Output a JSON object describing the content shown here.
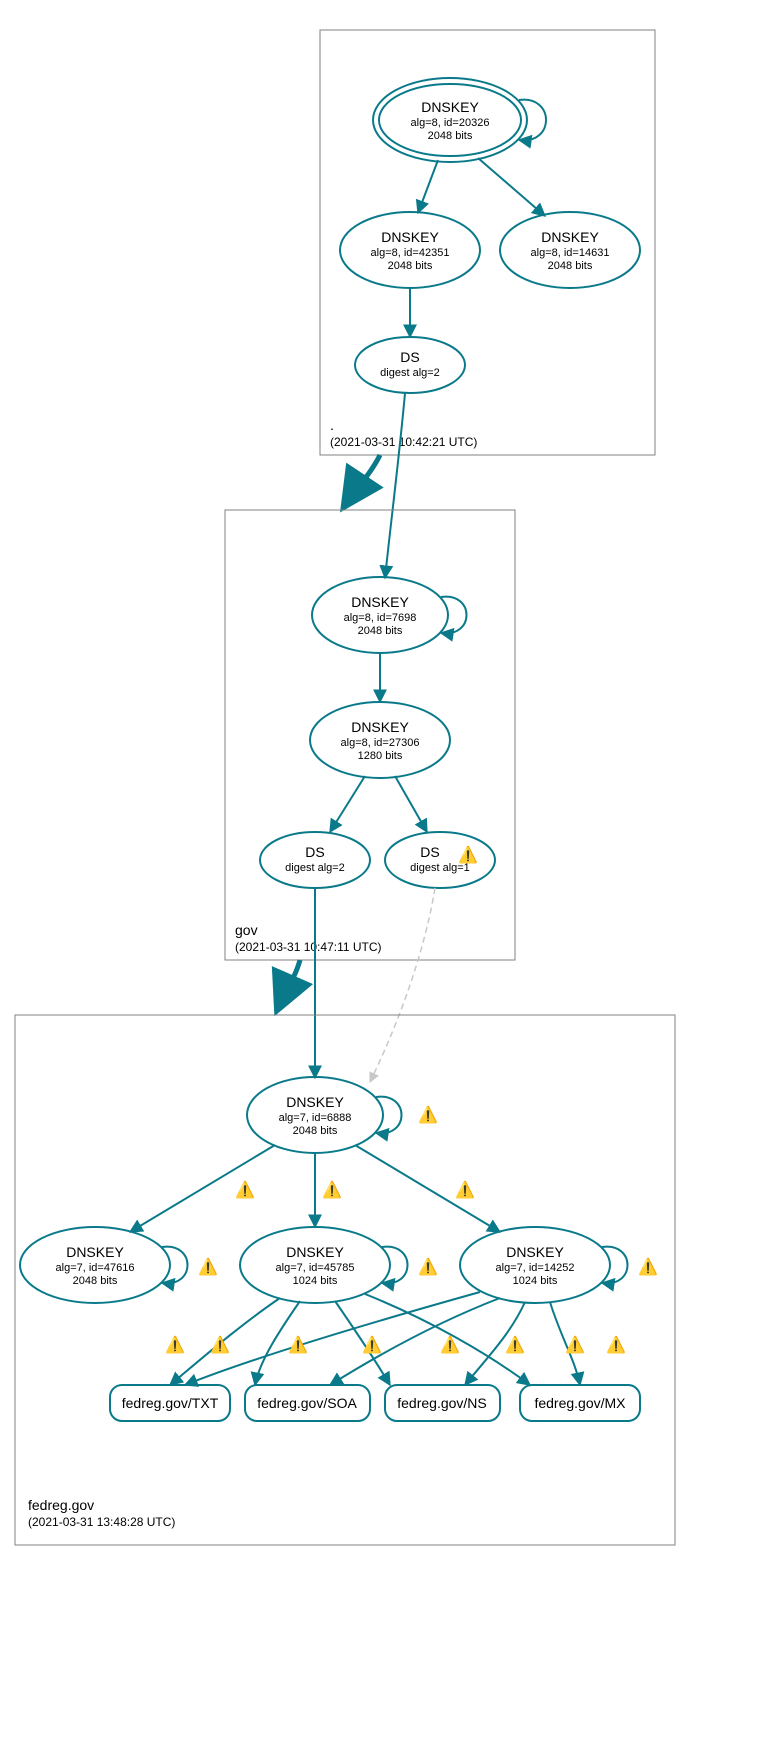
{
  "colors": {
    "teal": "#0a7a8a",
    "greyNode": "#d3d3d3",
    "zoneBorder": "#808080",
    "dashed": "#c8c8c8"
  },
  "warnIcon": "⚠️",
  "zones": {
    "root": {
      "title": ".",
      "timestamp": "(2021-03-31 10:42:21 UTC)"
    },
    "gov": {
      "title": "gov",
      "timestamp": "(2021-03-31 10:47:11 UTC)"
    },
    "fedreg": {
      "title": "fedreg.gov",
      "timestamp": "(2021-03-31 13:48:28 UTC)"
    }
  },
  "nodes": {
    "root_ksk": {
      "title": "DNSKEY",
      "line1": "alg=8, id=20326",
      "line2": "2048 bits"
    },
    "root_zsk1": {
      "title": "DNSKEY",
      "line1": "alg=8, id=42351",
      "line2": "2048 bits"
    },
    "root_zsk2": {
      "title": "DNSKEY",
      "line1": "alg=8, id=14631",
      "line2": "2048 bits"
    },
    "root_ds": {
      "title": "DS",
      "line1": "digest alg=2"
    },
    "gov_ksk": {
      "title": "DNSKEY",
      "line1": "alg=8, id=7698",
      "line2": "2048 bits"
    },
    "gov_zsk": {
      "title": "DNSKEY",
      "line1": "alg=8, id=27306",
      "line2": "1280 bits"
    },
    "gov_ds1": {
      "title": "DS",
      "line1": "digest alg=2"
    },
    "gov_ds2": {
      "title": "DS",
      "line1": "digest alg=1"
    },
    "fed_ksk": {
      "title": "DNSKEY",
      "line1": "alg=7, id=6888",
      "line2": "2048 bits"
    },
    "fed_k47616": {
      "title": "DNSKEY",
      "line1": "alg=7, id=47616",
      "line2": "2048 bits"
    },
    "fed_k45785": {
      "title": "DNSKEY",
      "line1": "alg=7, id=45785",
      "line2": "1024 bits"
    },
    "fed_k14252": {
      "title": "DNSKEY",
      "line1": "alg=7, id=14252",
      "line2": "1024 bits"
    }
  },
  "leaves": {
    "txt": "fedreg.gov/TXT",
    "soa": "fedreg.gov/SOA",
    "ns": "fedreg.gov/NS",
    "mx": "fedreg.gov/MX"
  }
}
